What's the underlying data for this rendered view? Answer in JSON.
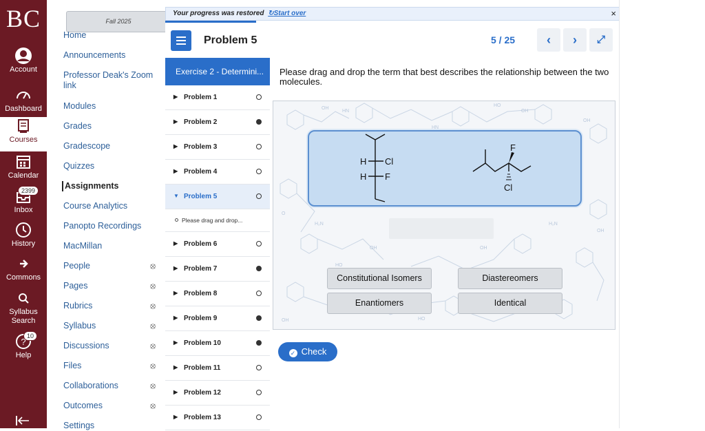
{
  "global_nav": {
    "logo": "BC",
    "items": [
      {
        "label": "Account",
        "icon": "account-icon"
      },
      {
        "label": "Dashboard",
        "icon": "dashboard-icon"
      },
      {
        "label": "Courses",
        "icon": "courses-icon",
        "active": true
      },
      {
        "label": "Calendar",
        "icon": "calendar-icon"
      },
      {
        "label": "Inbox",
        "icon": "inbox-icon",
        "badge": "2399"
      },
      {
        "label": "History",
        "icon": "history-icon"
      },
      {
        "label": "Commons",
        "icon": "commons-icon"
      },
      {
        "label": "Syllabus Search",
        "icon": "syllabus-search-icon"
      },
      {
        "label": "Help",
        "icon": "help-icon",
        "badge": "10"
      }
    ]
  },
  "course_nav": {
    "term": "Fall 2025",
    "items": [
      {
        "label": "Home"
      },
      {
        "label": "Announcements"
      },
      {
        "label": "Professor Deak's Zoom link"
      },
      {
        "label": "Modules"
      },
      {
        "label": "Grades"
      },
      {
        "label": "Gradescope"
      },
      {
        "label": "Quizzes"
      },
      {
        "label": "Assignments",
        "active": true
      },
      {
        "label": "Course Analytics"
      },
      {
        "label": "Panopto Recordings"
      },
      {
        "label": "MacMillan"
      },
      {
        "label": "People",
        "hidden": true
      },
      {
        "label": "Pages",
        "hidden": true
      },
      {
        "label": "Rubrics",
        "hidden": true
      },
      {
        "label": "Syllabus",
        "hidden": true
      },
      {
        "label": "Discussions",
        "hidden": true
      },
      {
        "label": "Files",
        "hidden": true
      },
      {
        "label": "Collaborations",
        "hidden": true
      },
      {
        "label": "Outcomes",
        "hidden": true
      },
      {
        "label": "Settings"
      }
    ]
  },
  "notice": {
    "message": "Your progress was restored",
    "link": "Start over",
    "close": "×"
  },
  "header": {
    "title": "Problem 5",
    "counter": "5 / 25",
    "prev": "‹",
    "next": "›",
    "expand": "⤢"
  },
  "problem_list": {
    "exercise": "Exercise 2 - Determini...",
    "problems": [
      {
        "label": "Problem 1",
        "status": "open"
      },
      {
        "label": "Problem 2",
        "status": "done"
      },
      {
        "label": "Problem 3",
        "status": "open"
      },
      {
        "label": "Problem 4",
        "status": "open"
      },
      {
        "label": "Problem 5",
        "status": "open",
        "active": true,
        "sub": "Please drag and drop..."
      },
      {
        "label": "Problem 6",
        "status": "open"
      },
      {
        "label": "Problem 7",
        "status": "done"
      },
      {
        "label": "Problem 8",
        "status": "open"
      },
      {
        "label": "Problem 9",
        "status": "done"
      },
      {
        "label": "Problem 10",
        "status": "done"
      },
      {
        "label": "Problem 11",
        "status": "open"
      },
      {
        "label": "Problem 12",
        "status": "open"
      },
      {
        "label": "Problem 13",
        "status": "open"
      }
    ]
  },
  "question": {
    "prompt": "Please drag and drop the term that best describes the relationship between the two molecules.",
    "molecule_a_labels": [
      "H",
      "Cl",
      "H",
      "F"
    ],
    "molecule_b_labels": [
      "F",
      "Cl"
    ],
    "terms": [
      "Constitutional Isomers",
      "Diastereomers",
      "Enantiomers",
      "Identical"
    ],
    "check": "Check"
  },
  "colors": {
    "global_nav_bg": "#6b1a24",
    "accent": "#2a6ec9",
    "active_row": "#e6eef9"
  }
}
